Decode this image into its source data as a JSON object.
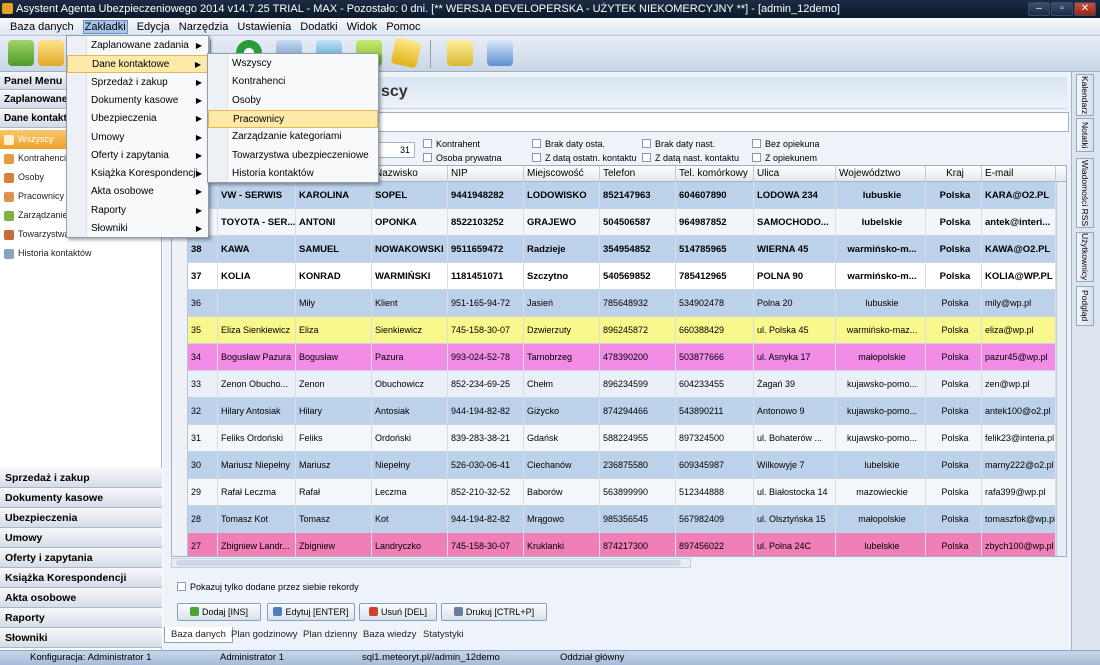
{
  "window": {
    "title": "Asystent Agenta Ubezpieczeniowego 2014 v14.7.25 TRIAL - MAX - Pozostało: 0 dni. [** WERSJA DEVELOPERSKA - UŻYTEK NIEKOMERCYJNY **] - [admin_12demo]",
    "buttons": [
      "–",
      "▫",
      "✕"
    ]
  },
  "menubar": [
    "Baza danych",
    "Zakładki",
    "Edycja",
    "Narzędzia",
    "Ustawienia",
    "Dodatki",
    "Widok",
    "Pomoc"
  ],
  "left_panel": {
    "title": "Panel Menu",
    "sections_top": [
      "Zaplanowane",
      "Dane kontakt"
    ],
    "items": [
      "Wszyscy",
      "Kontrahenci",
      "Osoby",
      "Pracownicy",
      "Zarządzanie",
      "Towarzystwa",
      "Historia kontaktów"
    ],
    "sections_bottom": [
      "Sprzedaż i zakup",
      "Dokumenty kasowe",
      "Ubezpieczenia",
      "Umowy",
      "Oferty i zapytania",
      "Książka Korespondencji",
      "Akta osobowe",
      "Raporty",
      "Słowniki"
    ]
  },
  "header_title": "Wszyscy",
  "header_title_visible": "scy",
  "combo_value": "31",
  "filters": [
    "Kontrahent",
    "Osoba prywatna",
    "Brak daty osta.",
    "Z datą ostatn. kontaktu",
    "Brak daty nast.",
    "Z datą nast. kontaktu",
    "Bez opiekuna",
    "Z opiekunem"
  ],
  "columns": [
    "",
    "",
    "Nazwisko",
    "NIP",
    "Miejscowość",
    "Telefon",
    "Tel. komórkowy",
    "Ulica",
    "Województwo",
    "Kraj",
    "E-mail"
  ],
  "rows": [
    {
      "id": "",
      "name": "VW - SERWIS",
      "first": "KAROLINA",
      "last": "SOPEL",
      "nip": "9441948282",
      "city": "LODOWISKO",
      "tel": "852147963",
      "mob": "604607890",
      "street": "LODOWA 234",
      "woj": "lubuskie",
      "kraj": "Polska",
      "mail": "KARA@O2.PL",
      "bg": "#bcd2ea",
      "bold": true
    },
    {
      "id": "",
      "name": "TOYOTA - SER...",
      "first": "ANTONI",
      "last": "OPONKA",
      "nip": "8522103252",
      "city": "GRAJEWO",
      "tel": "504506587",
      "mob": "964987852",
      "street": "SAMOCHODO...",
      "woj": "lubelskie",
      "kraj": "Polska",
      "mail": "antek@interi...",
      "bg": "#f2f6fb",
      "bold": true
    },
    {
      "id": "38",
      "name": "KAWA",
      "first": "SAMUEL",
      "last": "NOWAKOWSKI",
      "nip": "9511659472",
      "city": "Radzieje",
      "tel": "354954852",
      "mob": "514785965",
      "street": "WIERNA 45",
      "woj": "warmińsko-m...",
      "kraj": "Polska",
      "mail": "KAWA@O2.PL",
      "bg": "#bcd2ea",
      "bold": true
    },
    {
      "id": "37",
      "name": "KOLIA",
      "first": "KONRAD",
      "last": "WARMIŃSKI",
      "nip": "1181451071",
      "city": "Szczytno",
      "tel": "540569852",
      "mob": "785412965",
      "street": "POLNA 90",
      "woj": "warmińsko-m...",
      "kraj": "Polska",
      "mail": "KOLIA@WP.PL",
      "bg": "#ffffff",
      "bold": true
    },
    {
      "id": "36",
      "name": "",
      "first": "Miły",
      "last": "Klient",
      "nip": "951-165-94-72",
      "city": "Jasień",
      "tel": "785648932",
      "mob": "534902478",
      "street": "Polna 20",
      "woj": "lubuskie",
      "kraj": "Polska",
      "mail": "mily@wp.pl",
      "bg": "#bcd2ea",
      "bold": false
    },
    {
      "id": "35",
      "name": "Eliza Sienkiewicz",
      "first": "Eliza",
      "last": "Sienkiewicz",
      "nip": "745-158-30-07",
      "city": "Dzwierzuty",
      "tel": "896245872",
      "mob": "660388429",
      "street": "ul. Polska 45",
      "woj": "warmińsko-maz...",
      "kraj": "Polska",
      "mail": "eliza@wp.pl",
      "bg": "#f8f88c",
      "bold": false
    },
    {
      "id": "34",
      "name": "Bogusław Pazura",
      "first": "Bogusław",
      "last": "Pazura",
      "nip": "993-024-52-78",
      "city": "Tarnobrzeg",
      "tel": "478390200",
      "mob": "503877666",
      "street": "ul. Asnyka 17",
      "woj": "małopolskie",
      "kraj": "Polska",
      "mail": "pazur45@wp.pl",
      "bg": "#f28ce6",
      "bold": false
    },
    {
      "id": "33",
      "name": "Zenon Obucho...",
      "first": "Zenon",
      "last": "Obuchowicz",
      "nip": "852-234-69-25",
      "city": "Chełm",
      "tel": "896234599",
      "mob": "604233455",
      "street": "Żagań 39",
      "woj": "kujawsko-pomo...",
      "kraj": "Polska",
      "mail": "zen@wp.pl",
      "bg": "#e9f0f8",
      "bold": false
    },
    {
      "id": "32",
      "name": "Hilary Antosiak",
      "first": "Hilary",
      "last": "Antosiak",
      "nip": "944-194-82-82",
      "city": "Giżycko",
      "tel": "874294466",
      "mob": "543890211",
      "street": "Antonowo 9",
      "woj": "kujawsko-pomo...",
      "kraj": "Polska",
      "mail": "antek100@o2.pl",
      "bg": "#bcd2ea",
      "bold": false
    },
    {
      "id": "31",
      "name": "Feliks Ordoński",
      "first": "Feliks",
      "last": "Ordoński",
      "nip": "839-283-38-21",
      "city": "Gdańsk",
      "tel": "588224955",
      "mob": "897324500",
      "street": "ul. Bohaterów ...",
      "woj": "kujawsko-pomo...",
      "kraj": "Polska",
      "mail": "felik23@interia.pl",
      "bg": "#f3f7fb",
      "bold": false
    },
    {
      "id": "30",
      "name": "Mariusz Niepełny",
      "first": "Mariusz",
      "last": "Niepełny",
      "nip": "526-030-06-41",
      "city": "Ciechanów",
      "tel": "236875580",
      "mob": "609345987",
      "street": "Wilkowyje 7",
      "woj": "lubelskie",
      "kraj": "Polska",
      "mail": "marny222@o2.pl",
      "bg": "#bcd2ea",
      "bold": false
    },
    {
      "id": "29",
      "name": "Rafał Leczma",
      "first": "Rafał",
      "last": "Leczma",
      "nip": "852-210-32-52",
      "city": "Baborów",
      "tel": "563899990",
      "mob": "512344888",
      "street": "ul. Białostocka 14",
      "woj": "mazowieckie",
      "kraj": "Polska",
      "mail": "rafa399@wp.pl",
      "bg": "#f3f7fb",
      "bold": false
    },
    {
      "id": "28",
      "name": "Tomasz Kot",
      "first": "Tomasz",
      "last": "Kot",
      "nip": "944-194-82-82",
      "city": "Mrągowo",
      "tel": "985356545",
      "mob": "567982409",
      "street": "ul. Olsztyńska 15",
      "woj": "małopolskie",
      "kraj": "Polska",
      "mail": "tomaszfok@wp.pl",
      "bg": "#bcd2ea",
      "bold": false
    },
    {
      "id": "27",
      "name": "Zbigniew Landr...",
      "first": "Zbigniew",
      "last": "Landryczko",
      "nip": "745-158-30-07",
      "city": "Kruklanki",
      "tel": "874217300",
      "mob": "897456022",
      "street": "ul. Polna 24C",
      "woj": "lubelskie",
      "kraj": "Polska",
      "mail": "zbych100@wp.pl",
      "bg": "#f07fb8",
      "bold": false
    }
  ],
  "only_mine": "Pokazuj tylko dodane przez siebie rekordy",
  "buttons": {
    "add": "Dodaj [INS]",
    "edit": "Edytuj [ENTER]",
    "delete": "Usuń [DEL]",
    "print": "Drukuj [CTRL+P]"
  },
  "tabs": [
    "Baza danych",
    "Plan godzinowy",
    "Plan dzienny",
    "Baza wiedzy",
    "Statystyki"
  ],
  "side_tabs": [
    "Kalendarz",
    "Notatki",
    "Wiadomości RSS",
    "Użytkownicy",
    "Podgląd"
  ],
  "status": {
    "config": "Konfiguracja: Administrator 1",
    "user": "Administrator 1",
    "db": "sql1.meteoryt.pl//admin_12demo",
    "branch": "Oddział główny"
  },
  "menu_zakladki": [
    "Zaplanowane zadania",
    "Dane kontaktowe",
    "Sprzedaż i zakup",
    "Dokumenty kasowe",
    "Ubezpieczenia",
    "Umowy",
    "Oferty i zapytania",
    "Książka Korespondencji",
    "Akta osobowe",
    "Raporty",
    "Słowniki"
  ],
  "submenu_dane": [
    "Wszyscy",
    "Kontrahenci",
    "Osoby",
    "Pracownicy",
    "Zarządzanie kategoriami",
    "Towarzystwa ubezpieczeniowe",
    "Historia kontaktów"
  ],
  "colors": {
    "title_bg": "#142338",
    "selected_orange": "#f0a028",
    "menu_highlight": "#fde9a8"
  }
}
